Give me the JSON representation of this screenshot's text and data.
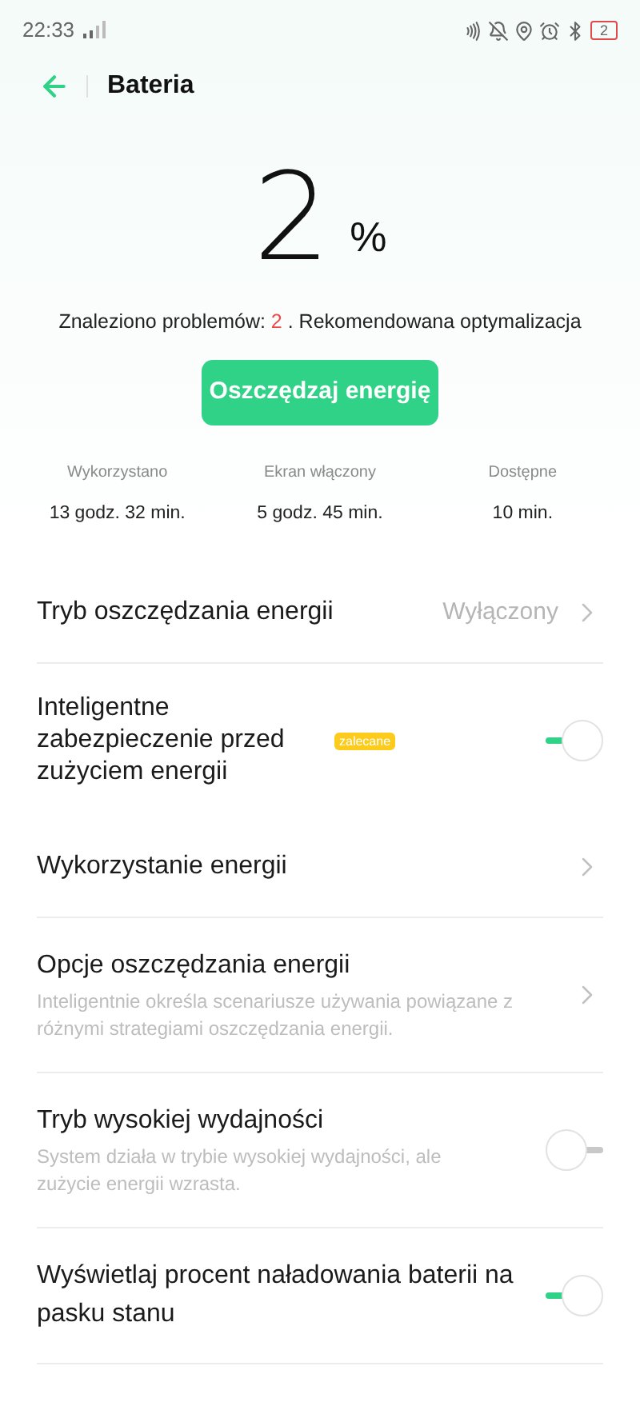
{
  "status_bar": {
    "time": "22:33",
    "battery": "2"
  },
  "header": {
    "title": "Bateria"
  },
  "battery": {
    "percent": "2",
    "unit": "%"
  },
  "problems": {
    "prefix": "Znaleziono problemów: ",
    "count": "2",
    "suffix": " . Rekomendowana optymalizacja"
  },
  "action_button": "Oszczędzaj energię",
  "stats": [
    {
      "label": "Wykorzystano",
      "value": "13 godz. 32 min."
    },
    {
      "label": "Ekran włączony",
      "value": "5 godz. 45 min."
    },
    {
      "label": "Dostępne",
      "value": "10 min."
    }
  ],
  "settings": [
    {
      "kind": "link",
      "title": "Tryb oszczędzania energii",
      "value": "Wyłączony",
      "divider": true
    },
    {
      "kind": "toggle",
      "title": "Inteligentne zabezpieczenie przed zużyciem energii",
      "badge": "zalecane",
      "on": true,
      "divider": false
    },
    {
      "kind": "link",
      "title": "Wykorzystanie energii",
      "divider": true
    },
    {
      "kind": "link",
      "title": "Opcje oszczędzania energii",
      "subtitle": "Inteligentnie określa scenariusze używania powiązane z różnymi strategiami oszczędzania energii.",
      "divider": true
    },
    {
      "kind": "toggle",
      "title": "Tryb wysokiej wydajności",
      "subtitle": "System działa w trybie wysokiej wydajności, ale zużycie energii wzrasta.",
      "on": false,
      "divider": true
    },
    {
      "kind": "toggle",
      "title": "Wyświetlaj procent naładowania baterii na pasku stanu",
      "on": true,
      "divider": true
    }
  ]
}
